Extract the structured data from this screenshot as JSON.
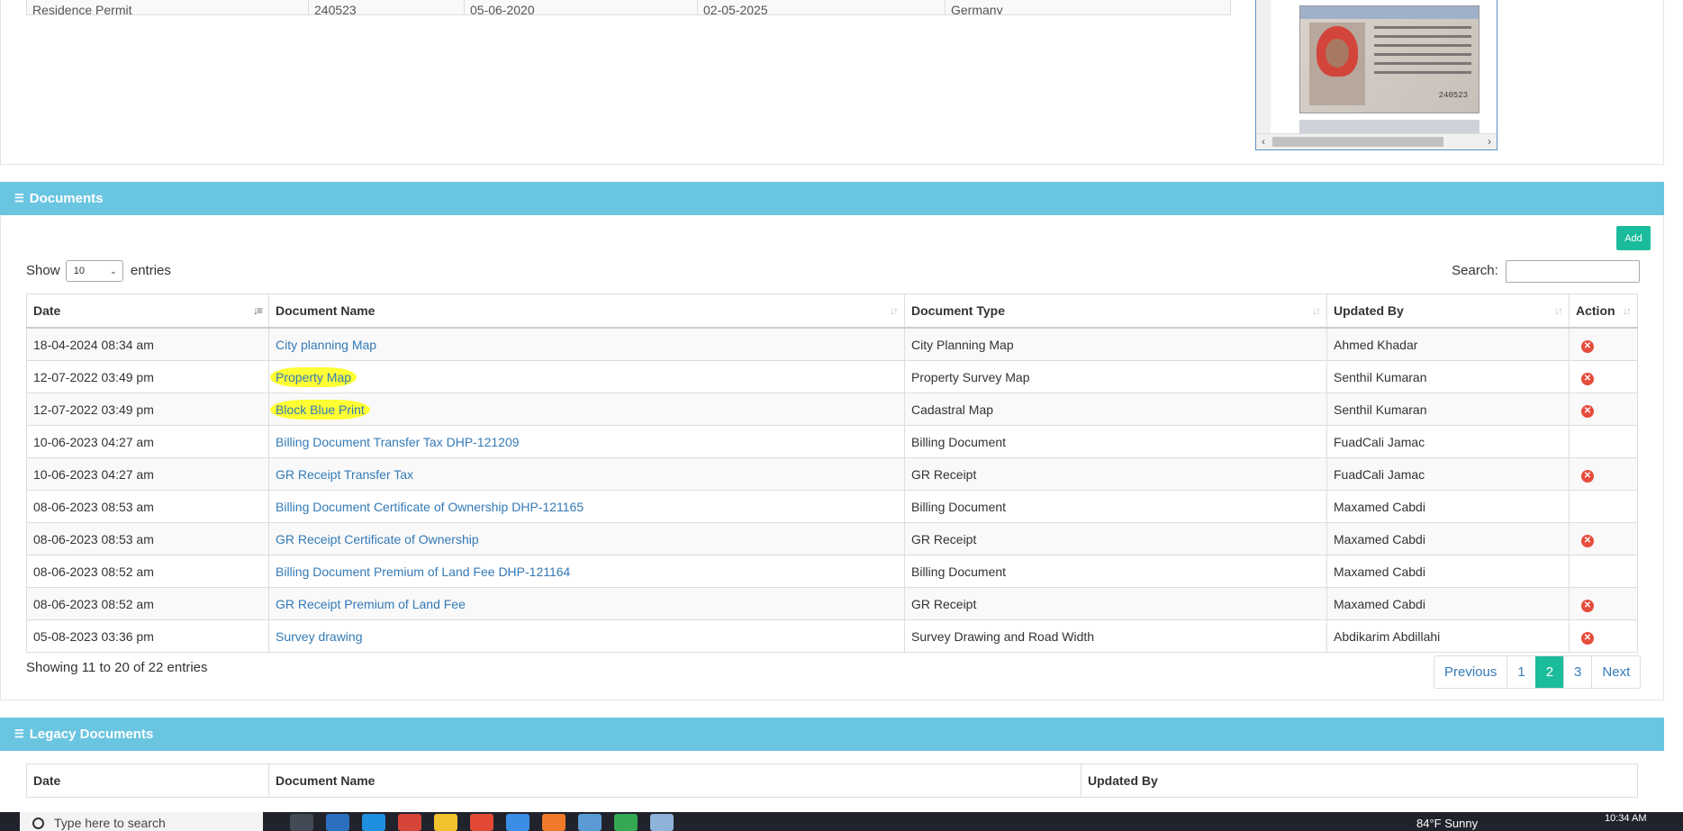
{
  "top": {
    "residence_row": [
      "Residence Permit",
      "240523",
      "05-06-2020",
      "02-05-2025",
      "Germany"
    ],
    "id_card_number": "240523"
  },
  "documents": {
    "title": "Documents",
    "add_label": "Add",
    "show_label": "Show",
    "entries_value": "10",
    "entries_label": "entries",
    "search_label": "Search:",
    "search_value": "",
    "columns": [
      "Date",
      "Document Name",
      "Document Type",
      "Updated By",
      "Action"
    ],
    "rows": [
      {
        "date": "18-04-2024 08:34 am",
        "name": "City planning Map",
        "type": "City Planning Map",
        "by": "Ahmed Khadar",
        "delete": true
      },
      {
        "date": "12-07-2022 03:49 pm",
        "name": "Property Map",
        "type": "Property Survey Map",
        "by": "Senthil Kumaran",
        "delete": true
      },
      {
        "date": "12-07-2022 03:49 pm",
        "name": "Block Blue Print",
        "type": "Cadastral Map",
        "by": "Senthil Kumaran",
        "delete": true
      },
      {
        "date": "10-06-2023 04:27 am",
        "name": "Billing Document Transfer Tax DHP-121209",
        "type": "Billing Document",
        "by": "FuadCali Jamac",
        "delete": false
      },
      {
        "date": "10-06-2023 04:27 am",
        "name": "GR Receipt Transfer Tax",
        "type": "GR Receipt",
        "by": "FuadCali Jamac",
        "delete": true
      },
      {
        "date": "08-06-2023 08:53 am",
        "name": "Billing Document Certificate of Ownership DHP-121165",
        "type": "Billing Document",
        "by": "Maxamed Cabdi",
        "delete": false
      },
      {
        "date": "08-06-2023 08:53 am",
        "name": "GR Receipt Certificate of Ownership",
        "type": "GR Receipt",
        "by": "Maxamed Cabdi",
        "delete": true
      },
      {
        "date": "08-06-2023 08:52 am",
        "name": "Billing Document Premium of Land Fee DHP-121164",
        "type": "Billing Document",
        "by": "Maxamed Cabdi",
        "delete": false
      },
      {
        "date": "08-06-2023 08:52 am",
        "name": "GR Receipt Premium of Land Fee",
        "type": "GR Receipt",
        "by": "Maxamed Cabdi",
        "delete": true
      },
      {
        "date": "05-08-2023 03:36 pm",
        "name": "Survey drawing",
        "type": "Survey Drawing and Road Width",
        "by": "Abdikarim Abdillahi",
        "delete": true
      }
    ],
    "showing": "Showing 11 to 20 of 22 entries",
    "pager": {
      "previous": "Previous",
      "pages": [
        "1",
        "2",
        "3"
      ],
      "active": "2",
      "next": "Next"
    }
  },
  "legacy": {
    "title": "Legacy Documents",
    "columns": [
      "Date",
      "Document Name",
      "Updated By"
    ]
  },
  "taskbar": {
    "search_placeholder": "Type here to search",
    "weather": "84°F  Sunny",
    "time": "10:34 AM",
    "icon_colors": [
      "#444a55",
      "#2c6fbf",
      "#1f8fe0",
      "#d6443a",
      "#f2c12e",
      "#e24a35",
      "#3a8ee6",
      "#f07a2a",
      "#5b9bd5",
      "#34a853",
      "#8db3d9"
    ]
  },
  "colors": {
    "section_header": "#6ac5e1",
    "accent": "#1bbc9b",
    "link": "#337ab7",
    "highlight": "#ffff33",
    "delete": "#e74c3c"
  }
}
